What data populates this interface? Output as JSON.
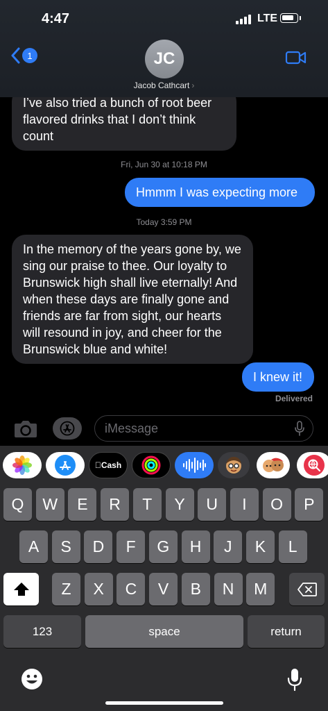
{
  "status_bar": {
    "time": "4:47",
    "network": "LTE",
    "battery_percent": 85
  },
  "header": {
    "back_badge": "1",
    "avatar_initials": "JC",
    "contact_name": "Jacob Cathcart",
    "contact_chevron": "›"
  },
  "messages": [
    {
      "type": "incoming",
      "text": "I’ve also tried a bunch of root beer flavored drinks that I don’t think count"
    },
    {
      "type": "timestamp",
      "text": "Fri, Jun 30 at 10:18 PM"
    },
    {
      "type": "outgoing",
      "text": "Hmmm I was expecting more"
    },
    {
      "type": "timestamp",
      "text": "Today 3:59 PM"
    },
    {
      "type": "incoming",
      "text": "In the memory of the years gone by, we sing our praise to thee. Our loyalty to Brunswick high shall live eternally! And when these days are finally gone and friends are far from sight, our hearts will resound in joy, and cheer for the Brunswick blue and white!"
    },
    {
      "type": "outgoing",
      "text": "I knew it!"
    },
    {
      "type": "status",
      "text": "Delivered"
    }
  ],
  "input_bar": {
    "placeholder": "iMessage"
  },
  "app_strip": [
    {
      "name": "photos",
      "icon": "photos-icon"
    },
    {
      "name": "app-store",
      "icon": "app-store-icon"
    },
    {
      "name": "apple-cash",
      "label": "Cash",
      "icon": "apple-cash-icon"
    },
    {
      "name": "activity",
      "icon": "activity-rings-icon"
    },
    {
      "name": "audio",
      "icon": "audio-waveform-icon"
    },
    {
      "name": "memoji",
      "icon": "memoji-icon"
    },
    {
      "name": "memoji-stickers",
      "icon": "memoji-stickers-icon"
    },
    {
      "name": "images-search",
      "icon": "globe-search-icon"
    }
  ],
  "keyboard": {
    "row1": [
      "Q",
      "W",
      "E",
      "R",
      "T",
      "Y",
      "U",
      "I",
      "O",
      "P"
    ],
    "row2": [
      "A",
      "S",
      "D",
      "F",
      "G",
      "H",
      "J",
      "K",
      "L"
    ],
    "row3": [
      "Z",
      "X",
      "C",
      "V",
      "B",
      "N",
      "M"
    ],
    "numbers_label": "123",
    "space_label": "space",
    "return_label": "return"
  },
  "colors": {
    "outgoing_bubble": "#2f7cf6",
    "incoming_bubble": "#26262a",
    "accent": "#2f7cf6"
  }
}
